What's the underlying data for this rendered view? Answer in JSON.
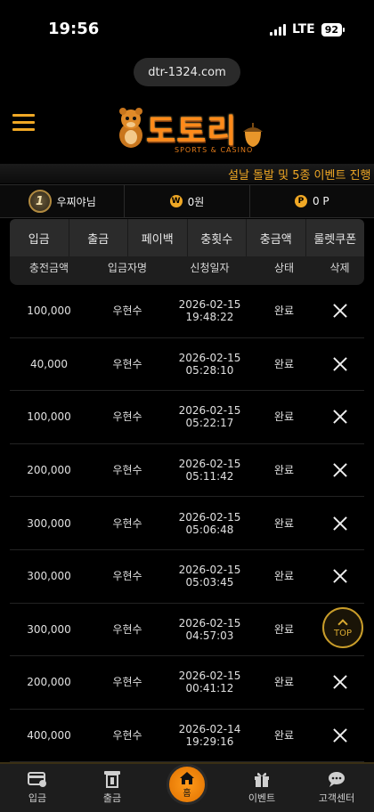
{
  "status_bar": {
    "time": "19:56",
    "network": "LTE",
    "battery": "92"
  },
  "browser": {
    "url": "dtr-1324.com"
  },
  "header": {
    "logo_text": "도토리",
    "logo_sub": "SPORTS & CASINO"
  },
  "marquee": {
    "text": "설날 돌발 및 5종 이벤트 진행"
  },
  "user_bar": {
    "level": "1",
    "nickname": "우찌야님",
    "money": "0원",
    "money_icon": "W",
    "point": "0 P",
    "point_icon": "P"
  },
  "tabs": [
    "입금",
    "출금",
    "페이백",
    "충횟수",
    "충금액",
    "룰렛쿠폰"
  ],
  "table": {
    "columns": [
      "충전금액",
      "입금자명",
      "신청일자",
      "상태",
      "삭제"
    ],
    "rows": [
      {
        "amount": "100,000",
        "name": "우현수",
        "date": "2026-02-15",
        "time": "19:48:22",
        "status": "완료"
      },
      {
        "amount": "40,000",
        "name": "우현수",
        "date": "2026-02-15",
        "time": "05:28:10",
        "status": "완료"
      },
      {
        "amount": "100,000",
        "name": "우현수",
        "date": "2026-02-15",
        "time": "05:22:17",
        "status": "완료"
      },
      {
        "amount": "200,000",
        "name": "우현수",
        "date": "2026-02-15",
        "time": "05:11:42",
        "status": "완료"
      },
      {
        "amount": "300,000",
        "name": "우현수",
        "date": "2026-02-15",
        "time": "05:06:48",
        "status": "완료"
      },
      {
        "amount": "300,000",
        "name": "우현수",
        "date": "2026-02-15",
        "time": "05:03:45",
        "status": "완료"
      },
      {
        "amount": "300,000",
        "name": "우현수",
        "date": "2026-02-15",
        "time": "04:57:03",
        "status": "완료"
      },
      {
        "amount": "200,000",
        "name": "우현수",
        "date": "2026-02-15",
        "time": "00:41:12",
        "status": "완료"
      },
      {
        "amount": "400,000",
        "name": "우현수",
        "date": "2026-02-14",
        "time": "19:29:16",
        "status": "완료"
      }
    ]
  },
  "top_button": {
    "label": "TOP"
  },
  "bottom_nav": {
    "deposit": "입금",
    "withdraw": "출금",
    "home": "홈",
    "event": "이벤트",
    "support": "고객센터"
  },
  "colors": {
    "accent": "#f0a825",
    "background": "#000000",
    "logo": "#ff8a1a"
  }
}
